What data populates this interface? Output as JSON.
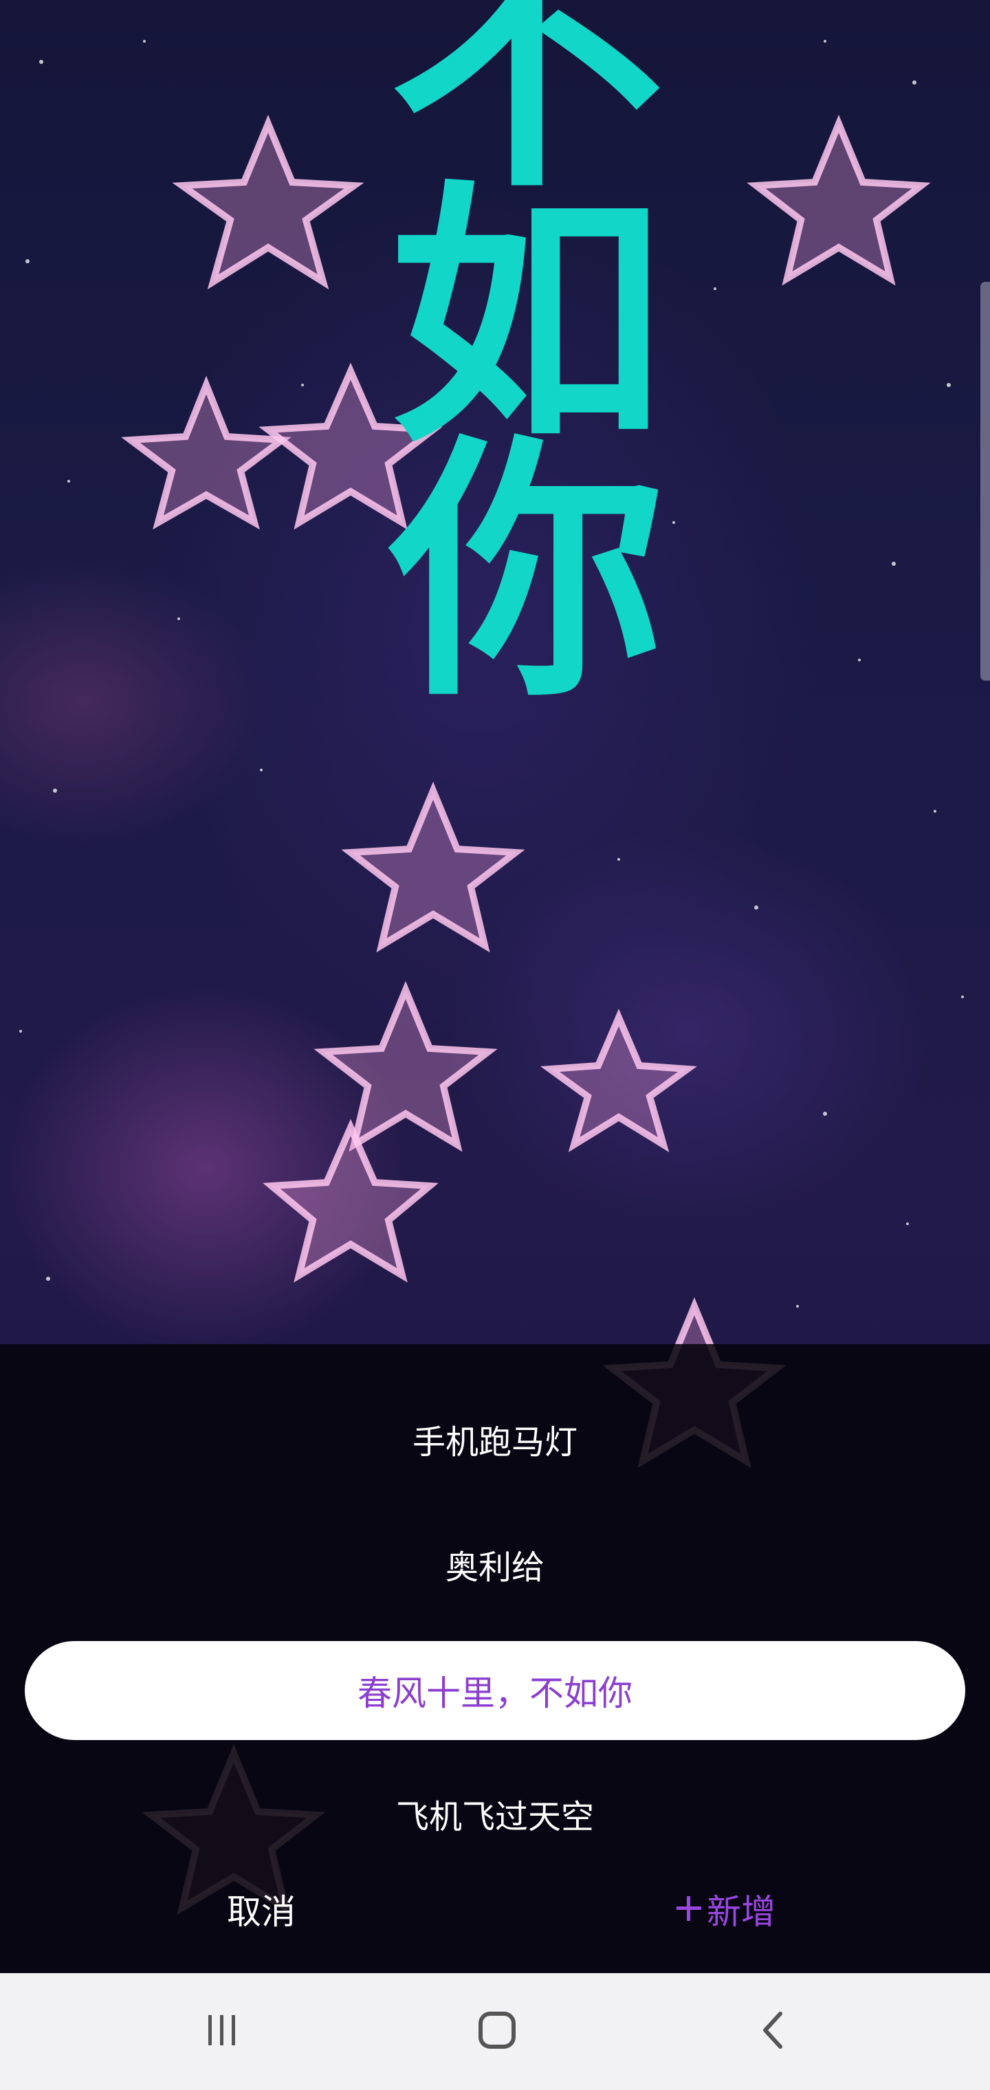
{
  "marquee": {
    "text": "不如你",
    "color": "#12d6c8"
  },
  "list": {
    "items": [
      {
        "label": "手机跑马灯"
      },
      {
        "label": "奥利给"
      },
      {
        "label": "春风十里，不如你"
      },
      {
        "label": "飞机飞过天空"
      }
    ],
    "selected_index": 2
  },
  "actions": {
    "cancel_label": "取消",
    "add_icon": "plus-icon",
    "add_label": "新增",
    "accent": "#9a47e2"
  },
  "navbar": {
    "recents_icon": "recent-apps-icon",
    "home_icon": "home-icon",
    "back_icon": "back-icon"
  }
}
